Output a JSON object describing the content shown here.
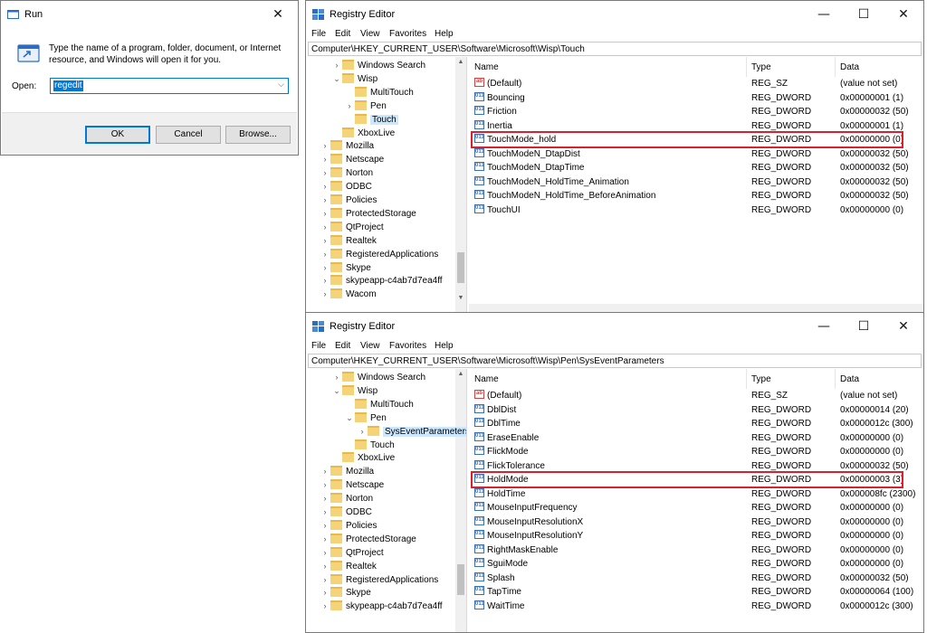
{
  "run": {
    "title": "Run",
    "description": "Type the name of a program, folder, document, or Internet resource, and Windows will open it for you.",
    "open_label": "Open:",
    "open_value": "regedit",
    "ok": "OK",
    "cancel": "Cancel",
    "browse": "Browse..."
  },
  "regedit_top": {
    "title": "Registry Editor",
    "menu": [
      "File",
      "Edit",
      "View",
      "Favorites",
      "Help"
    ],
    "address": "Computer\\HKEY_CURRENT_USER\\Software\\Microsoft\\Wisp\\Touch",
    "tree": [
      {
        "label": "Windows Search",
        "expander": ">"
      },
      {
        "label": "Wisp",
        "expander": "v"
      },
      {
        "label": "MultiTouch",
        "expander": ""
      },
      {
        "label": "Pen",
        "expander": ">"
      },
      {
        "label": "Touch",
        "expander": "",
        "selected": true
      },
      {
        "label": "XboxLive",
        "expander": ""
      },
      {
        "label": "Mozilla",
        "expander": ">"
      },
      {
        "label": "Netscape",
        "expander": ">"
      },
      {
        "label": "Norton",
        "expander": ">"
      },
      {
        "label": "ODBC",
        "expander": ">"
      },
      {
        "label": "Policies",
        "expander": ">"
      },
      {
        "label": "ProtectedStorage",
        "expander": ">"
      },
      {
        "label": "QtProject",
        "expander": ">"
      },
      {
        "label": "Realtek",
        "expander": ">"
      },
      {
        "label": "RegisteredApplications",
        "expander": ">"
      },
      {
        "label": "Skype",
        "expander": ">"
      },
      {
        "label": "skypeapp-c4ab7d7ea4ff",
        "expander": ">"
      },
      {
        "label": "Wacom",
        "expander": ">"
      }
    ],
    "columns": [
      "Name",
      "Type",
      "Data"
    ],
    "values": [
      {
        "name": "(Default)",
        "type": "REG_SZ",
        "data": "(value not set)",
        "kind": "str"
      },
      {
        "name": "Bouncing",
        "type": "REG_DWORD",
        "data": "0x00000001 (1)",
        "kind": "bin"
      },
      {
        "name": "Friction",
        "type": "REG_DWORD",
        "data": "0x00000032 (50)",
        "kind": "bin"
      },
      {
        "name": "Inertia",
        "type": "REG_DWORD",
        "data": "0x00000001 (1)",
        "kind": "bin"
      },
      {
        "name": "TouchMode_hold",
        "type": "REG_DWORD",
        "data": "0x00000000 (0)",
        "kind": "bin"
      },
      {
        "name": "TouchModeN_DtapDist",
        "type": "REG_DWORD",
        "data": "0x00000032 (50)",
        "kind": "bin"
      },
      {
        "name": "TouchModeN_DtapTime",
        "type": "REG_DWORD",
        "data": "0x00000032 (50)",
        "kind": "bin"
      },
      {
        "name": "TouchModeN_HoldTime_Animation",
        "type": "REG_DWORD",
        "data": "0x00000032 (50)",
        "kind": "bin"
      },
      {
        "name": "TouchModeN_HoldTime_BeforeAnimation",
        "type": "REG_DWORD",
        "data": "0x00000032 (50)",
        "kind": "bin"
      },
      {
        "name": "TouchUI",
        "type": "REG_DWORD",
        "data": "0x00000000 (0)",
        "kind": "bin"
      }
    ],
    "highlighted_value": "TouchMode_hold"
  },
  "regedit_bottom": {
    "title": "Registry Editor",
    "menu": [
      "File",
      "Edit",
      "View",
      "Favorites",
      "Help"
    ],
    "address": "Computer\\HKEY_CURRENT_USER\\Software\\Microsoft\\Wisp\\Pen\\SysEventParameters",
    "tree": [
      {
        "label": "Windows Search",
        "expander": ">"
      },
      {
        "label": "Wisp",
        "expander": "v"
      },
      {
        "label": "MultiTouch",
        "expander": ""
      },
      {
        "label": "Pen",
        "expander": "v"
      },
      {
        "label": "SysEventParameters",
        "expander": ">",
        "selected": true
      },
      {
        "label": "Touch",
        "expander": ""
      },
      {
        "label": "XboxLive",
        "expander": ""
      },
      {
        "label": "Mozilla",
        "expander": ">"
      },
      {
        "label": "Netscape",
        "expander": ">"
      },
      {
        "label": "Norton",
        "expander": ">"
      },
      {
        "label": "ODBC",
        "expander": ">"
      },
      {
        "label": "Policies",
        "expander": ">"
      },
      {
        "label": "ProtectedStorage",
        "expander": ">"
      },
      {
        "label": "QtProject",
        "expander": ">"
      },
      {
        "label": "Realtek",
        "expander": ">"
      },
      {
        "label": "RegisteredApplications",
        "expander": ">"
      },
      {
        "label": "Skype",
        "expander": ">"
      },
      {
        "label": "skypeapp-c4ab7d7ea4ff",
        "expander": ">"
      }
    ],
    "columns": [
      "Name",
      "Type",
      "Data"
    ],
    "values": [
      {
        "name": "(Default)",
        "type": "REG_SZ",
        "data": "(value not set)",
        "kind": "str"
      },
      {
        "name": "DblDist",
        "type": "REG_DWORD",
        "data": "0x00000014 (20)",
        "kind": "bin"
      },
      {
        "name": "DblTime",
        "type": "REG_DWORD",
        "data": "0x0000012c (300)",
        "kind": "bin"
      },
      {
        "name": "EraseEnable",
        "type": "REG_DWORD",
        "data": "0x00000000 (0)",
        "kind": "bin"
      },
      {
        "name": "FlickMode",
        "type": "REG_DWORD",
        "data": "0x00000000 (0)",
        "kind": "bin"
      },
      {
        "name": "FlickTolerance",
        "type": "REG_DWORD",
        "data": "0x00000032 (50)",
        "kind": "bin"
      },
      {
        "name": "HoldMode",
        "type": "REG_DWORD",
        "data": "0x00000003 (3)",
        "kind": "bin"
      },
      {
        "name": "HoldTime",
        "type": "REG_DWORD",
        "data": "0x000008fc (2300)",
        "kind": "bin"
      },
      {
        "name": "MouseInputFrequency",
        "type": "REG_DWORD",
        "data": "0x00000000 (0)",
        "kind": "bin"
      },
      {
        "name": "MouseInputResolutionX",
        "type": "REG_DWORD",
        "data": "0x00000000 (0)",
        "kind": "bin"
      },
      {
        "name": "MouseInputResolutionY",
        "type": "REG_DWORD",
        "data": "0x00000000 (0)",
        "kind": "bin"
      },
      {
        "name": "RightMaskEnable",
        "type": "REG_DWORD",
        "data": "0x00000000 (0)",
        "kind": "bin"
      },
      {
        "name": "SguiMode",
        "type": "REG_DWORD",
        "data": "0x00000000 (0)",
        "kind": "bin"
      },
      {
        "name": "Splash",
        "type": "REG_DWORD",
        "data": "0x00000032 (50)",
        "kind": "bin"
      },
      {
        "name": "TapTime",
        "type": "REG_DWORD",
        "data": "0x00000064 (100)",
        "kind": "bin"
      },
      {
        "name": "WaitTime",
        "type": "REG_DWORD",
        "data": "0x0000012c (300)",
        "kind": "bin"
      }
    ],
    "highlighted_value": "HoldMode"
  },
  "icons": {
    "run": "run-icon",
    "regedit": "registry-editor-icon",
    "string_value": "string-value-icon",
    "dword_value": "dword-value-icon",
    "folder": "folder-icon"
  },
  "colors": {
    "highlight_border": "#d9202b",
    "selection": "#cce8ff",
    "accent": "#0078d7"
  }
}
